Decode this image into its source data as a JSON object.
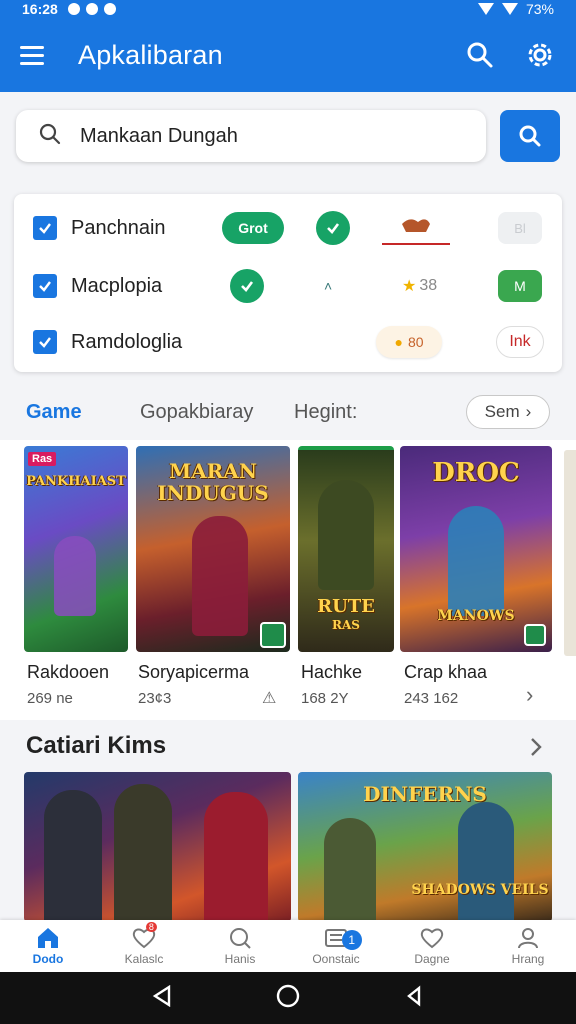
{
  "status_bar": {
    "time": "16:28",
    "battery": "73%"
  },
  "app_bar": {
    "title": "Apkalibaran"
  },
  "search": {
    "query": "Mankaan Dungah"
  },
  "filters": [
    {
      "label": "Panchnain",
      "pill": "Grot",
      "ghost": "Bl"
    },
    {
      "label": "Macplopia",
      "score": "38",
      "badge": "M"
    },
    {
      "label": "Ramdologlia",
      "score_pill": "80",
      "link_pill": "Ink"
    }
  ],
  "tabs": {
    "items": [
      "Game",
      "Gopakbiaray",
      "Hegint:"
    ],
    "see_all": "Sem"
  },
  "games": [
    {
      "name": "Rakdooen",
      "sub": "269 ne",
      "art_title": "PANKHAIAST",
      "badge": "Ras"
    },
    {
      "name": "Soryapicerma",
      "sub": "23¢3",
      "art_title": "MARAN INDUGUS"
    },
    {
      "name": "Hachke",
      "sub": "168 2Y",
      "art_title": "RUTE",
      "art_sub": "RAS"
    },
    {
      "name": "Crap khaa",
      "sub": "243 162",
      "art_title": "DROC",
      "art_sub": "MANOWS"
    }
  ],
  "section_title": "Catiari Kims",
  "featured": [
    {
      "name": "featured-1"
    },
    {
      "name": "featured-2",
      "art_title": "DINFERNS",
      "art_sub": "SHADOWS VEILS"
    }
  ],
  "bottom_nav": [
    {
      "label": "Dodo",
      "icon": "home-icon",
      "active": true
    },
    {
      "label": "Kalaslc",
      "icon": "heart-icon",
      "badge": "8"
    },
    {
      "label": "Hanis",
      "icon": "search-icon"
    },
    {
      "label": "Oonstaic",
      "icon": "list-icon",
      "badge": "1"
    },
    {
      "label": "Dagne",
      "icon": "heart-outline-icon"
    },
    {
      "label": "Hrang",
      "icon": "person-icon"
    }
  ],
  "colors": {
    "primary": "#1976e0",
    "green": "#17a366",
    "background": "#f3f4f7"
  }
}
